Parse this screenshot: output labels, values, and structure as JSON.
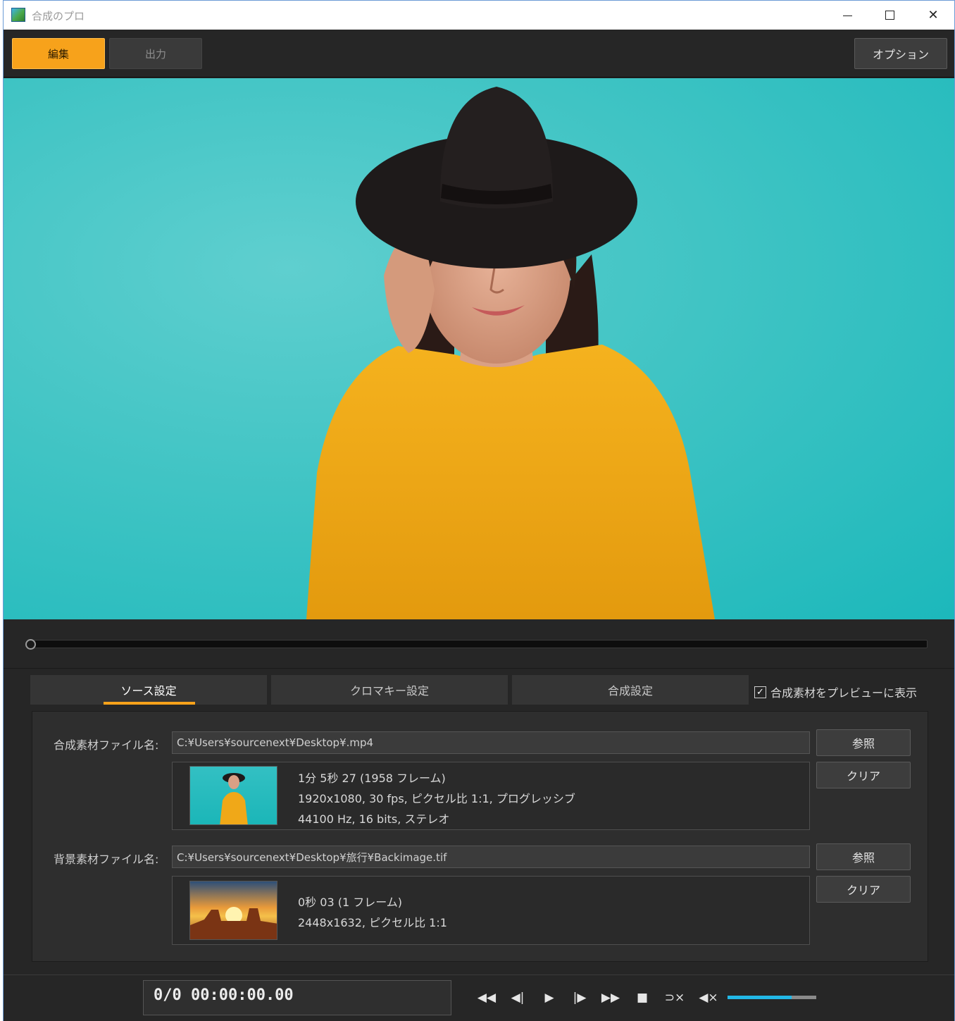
{
  "window": {
    "title": "合成のプロ"
  },
  "toolbar": {
    "edit_label": "編集",
    "output_label": "出力",
    "options_label": "オプション",
    "active_mode": "edit"
  },
  "tabs": {
    "source": "ソース設定",
    "chroma": "クロマキー設定",
    "composite": "合成設定",
    "active": "source"
  },
  "preview_checkbox": {
    "label": "合成素材をプレビューに表示",
    "checked": true
  },
  "composite_material": {
    "label": "合成素材ファイル名:",
    "path": "C:¥Users¥sourcenext¥Desktop¥.mp4",
    "browse_label": "参照",
    "clear_label": "クリア",
    "info": [
      "1分 5秒 27 (1958 フレーム)",
      "1920x1080, 30 fps, ピクセル比 1:1, プログレッシブ",
      "44100 Hz, 16 bits, ステレオ"
    ]
  },
  "background_material": {
    "label": "背景素材ファイル名:",
    "path": "C:¥Users¥sourcenext¥Desktop¥旅行¥Backimage.tif",
    "browse_label": "参照",
    "clear_label": "クリア",
    "info": [
      "0秒 03 (1 フレーム)",
      "2448x1632, ピクセル比 1:1"
    ]
  },
  "transport": {
    "timecode": "0/0 00:00:00.00",
    "controls": [
      "rewind-icon",
      "step-back-icon",
      "play-icon",
      "step-forward-icon",
      "fast-forward-icon",
      "stop-icon",
      "loop-off-icon",
      "mute-icon"
    ],
    "volume_fraction": 0.72,
    "seek_position": 0
  },
  "colors": {
    "accent": "#f7a21b",
    "volume": "#22b8e6",
    "preview_bg": "#40c4c4"
  }
}
